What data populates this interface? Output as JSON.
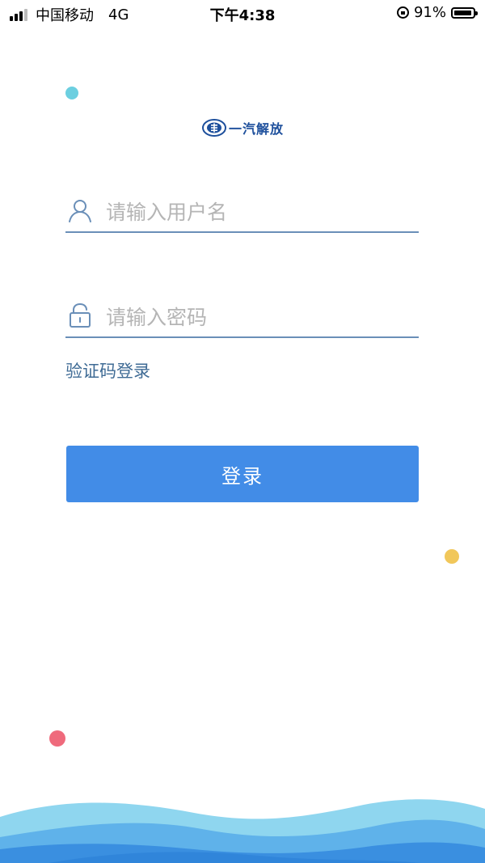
{
  "status_bar": {
    "carrier": "中国移动",
    "network": "4G",
    "time": "下午4:38",
    "battery": "91%"
  },
  "logo": {
    "text": "一汽解放"
  },
  "form": {
    "username_placeholder": "请输入用户名",
    "password_placeholder": "请输入密码",
    "sms_login_label": "验证码登录",
    "login_button_label": "登录"
  },
  "colors": {
    "accent": "#428ce7",
    "link": "#3f6b95",
    "logo": "#1d4f9c",
    "dot_cyan": "#6ccfe0",
    "dot_yellow": "#f1c75a",
    "dot_red": "#ef6a7c"
  },
  "icons": {
    "username": "user-icon",
    "password": "lock-icon"
  }
}
